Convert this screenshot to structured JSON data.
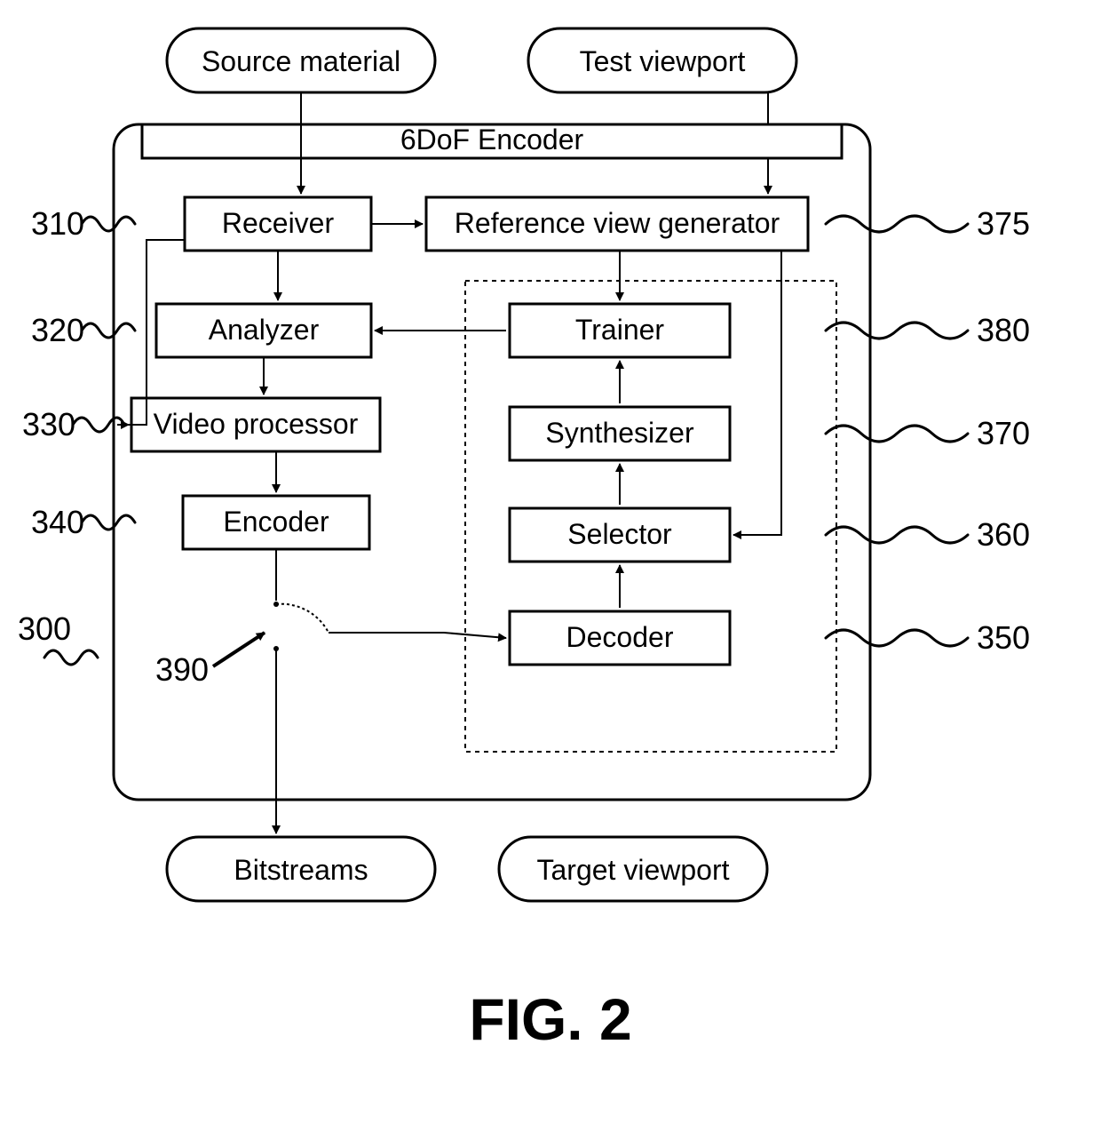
{
  "figure_label": "FIG. 2",
  "container_title": "6DoF Encoder",
  "top": {
    "source": "Source material",
    "test": "Test viewport"
  },
  "left_col": {
    "receiver": "Receiver",
    "analyzer": "Analyzer",
    "video_processor": "Video processor",
    "encoder": "Encoder"
  },
  "right_col": {
    "ref_gen": "Reference view generator",
    "trainer": "Trainer",
    "synthesizer": "Synthesizer",
    "selector": "Selector",
    "decoder": "Decoder"
  },
  "bottom": {
    "bitstreams": "Bitstreams",
    "target": "Target viewport"
  },
  "refs": {
    "r300": "300",
    "r310": "310",
    "r320": "320",
    "r330": "330",
    "r340": "340",
    "r350": "350",
    "r360": "360",
    "r370": "370",
    "r375": "375",
    "r380": "380",
    "r390": "390"
  }
}
